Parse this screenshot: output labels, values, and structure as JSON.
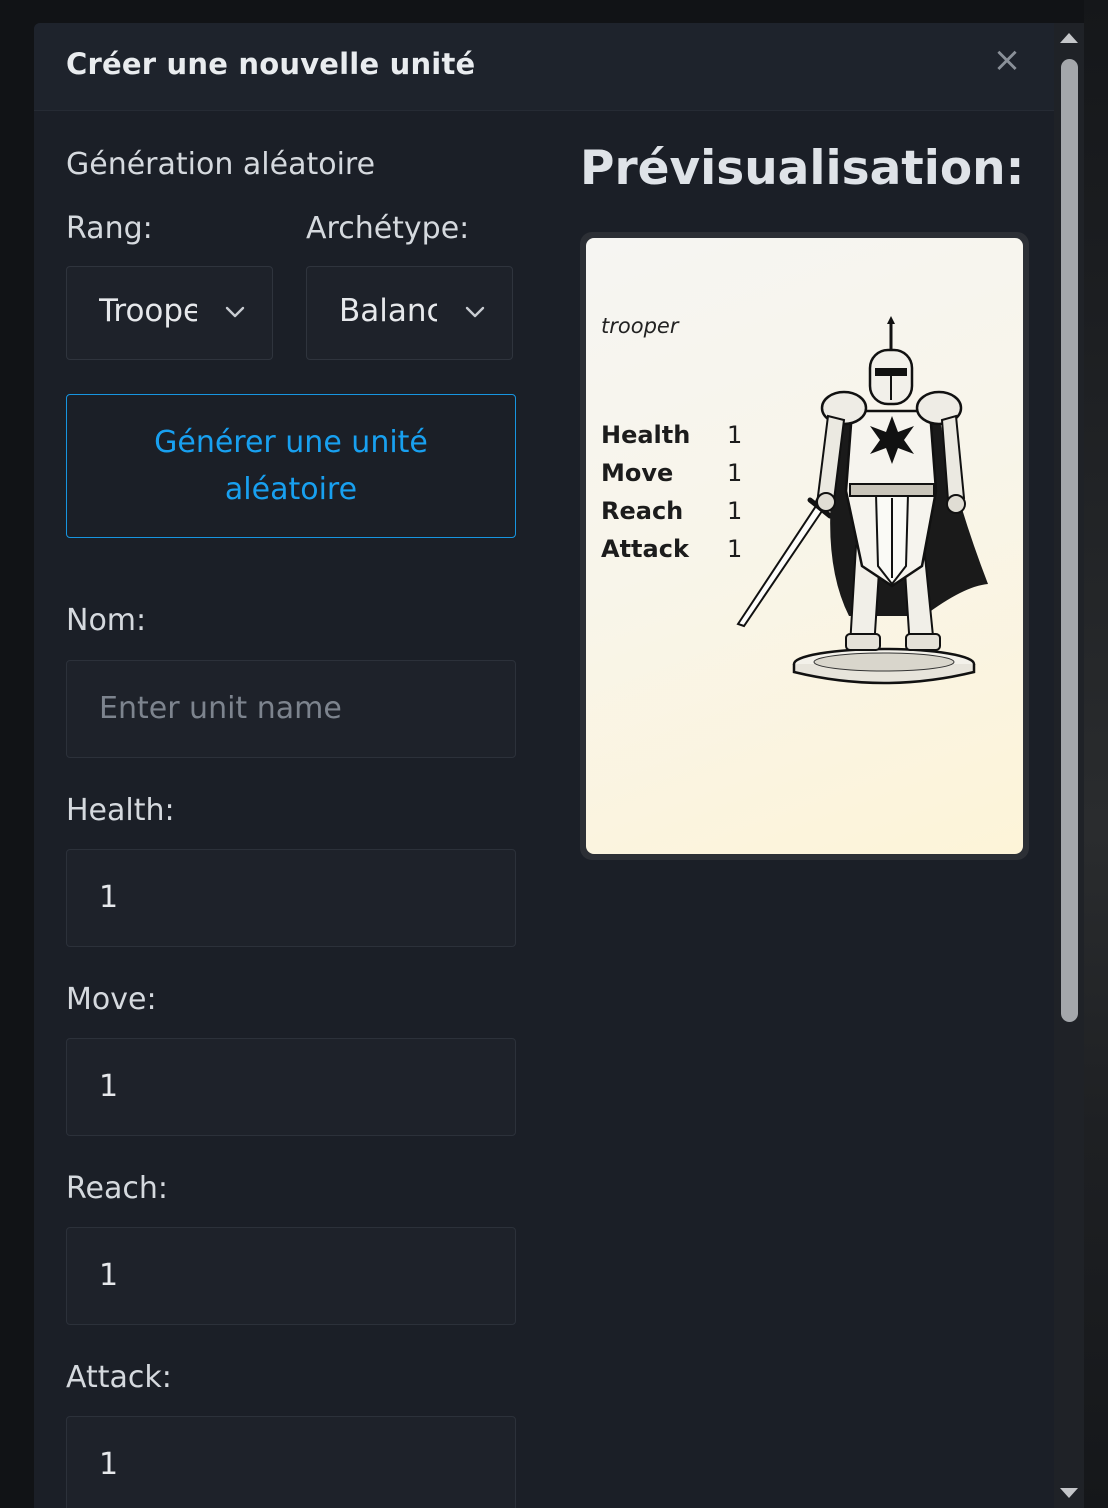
{
  "modal": {
    "title": "Créer une nouvelle unité",
    "close_symbol": "×"
  },
  "random_generation": {
    "section_title": "Génération aléatoire",
    "rank_label": "Rang:",
    "rank_value": "Trooper",
    "archetype_label": "Archétype:",
    "archetype_value": "Balanced",
    "generate_button": "Générer une unité aléatoire"
  },
  "form": {
    "name_label": "Nom:",
    "name_placeholder": "Enter unit name",
    "name_value": "",
    "health_label": "Health:",
    "health_value": "1",
    "move_label": "Move:",
    "move_value": "1",
    "reach_label": "Reach:",
    "reach_value": "1",
    "attack_label": "Attack:",
    "attack_value": "1"
  },
  "preview": {
    "title": "Prévisualisation:",
    "card": {
      "unit_type": "trooper",
      "stats": [
        {
          "name": "Health",
          "value": "1"
        },
        {
          "name": "Move",
          "value": "1"
        },
        {
          "name": "Reach",
          "value": "1"
        },
        {
          "name": "Attack",
          "value": "1"
        }
      ],
      "image": "knight-illustration"
    }
  },
  "icons": {
    "close": "close-icon",
    "select": "chevron-down-icon",
    "scroll_up": "scroll-up-arrow-icon",
    "scroll_down": "scroll-down-arrow-icon"
  },
  "colors": {
    "accent": "#18a0f0",
    "modal_bg": "#1b1f27",
    "card_bg": "#f8f5ea"
  }
}
